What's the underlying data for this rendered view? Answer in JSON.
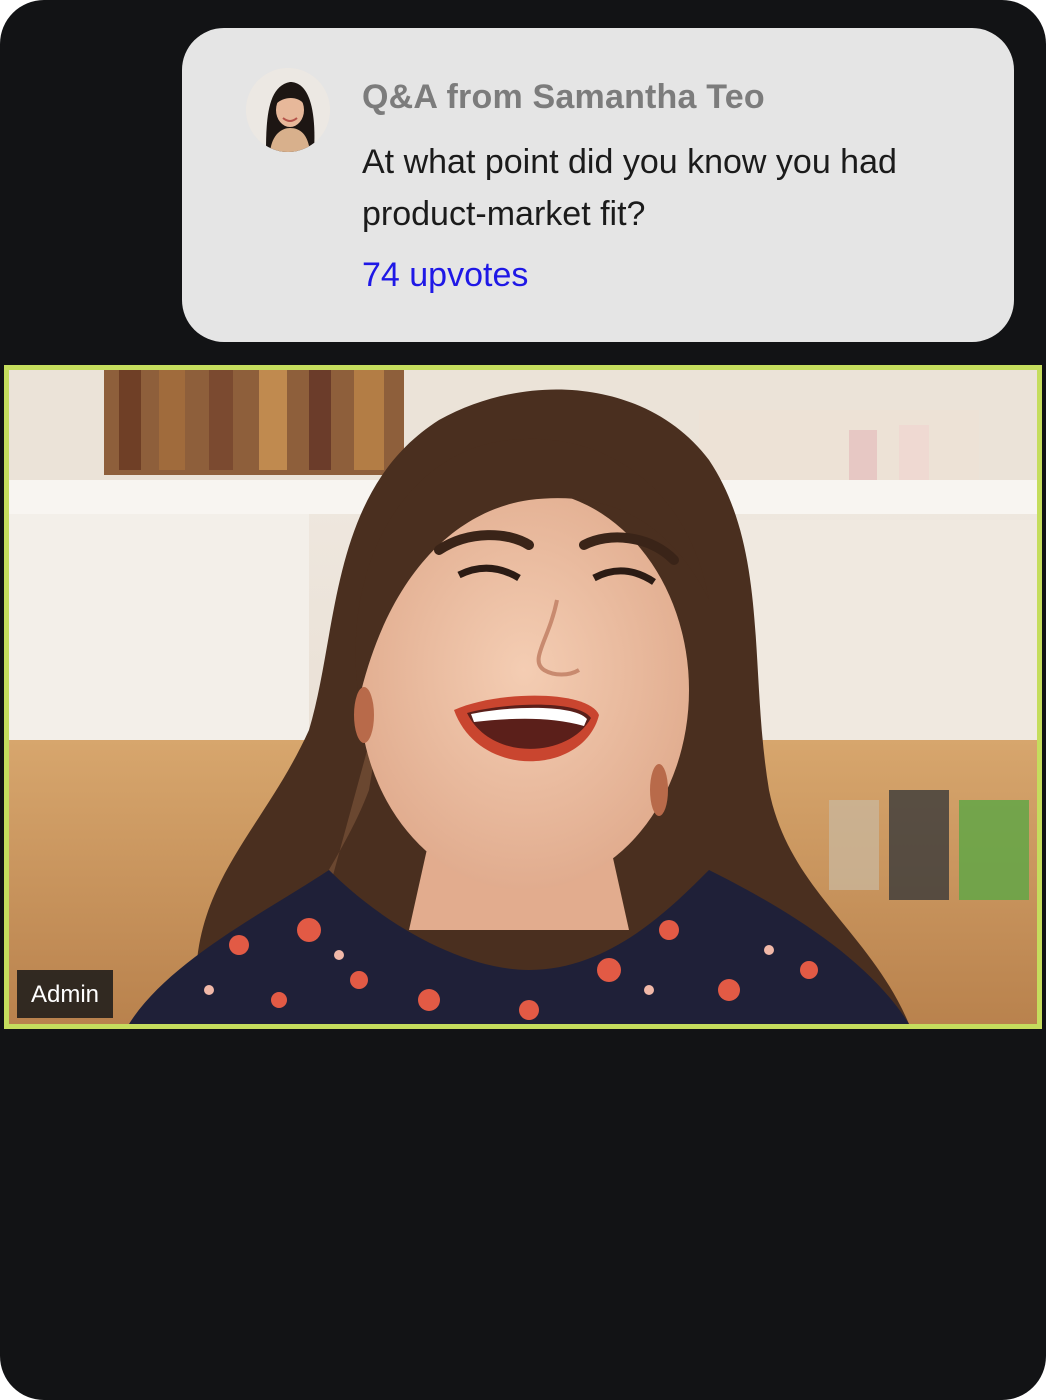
{
  "qa": {
    "title": "Q&A from Samantha Teo",
    "question": "At what point did you know you had product-market fit?",
    "upvotes": "74 upvotes",
    "avatar_icon": "user-avatar-photo",
    "upvotes_color": "#1f18e6"
  },
  "video": {
    "participant_name": "Admin",
    "active_speaker_border_color": "#c5dd5d"
  },
  "theme": {
    "background": "#121315",
    "card_background": "#e5e5e5"
  }
}
